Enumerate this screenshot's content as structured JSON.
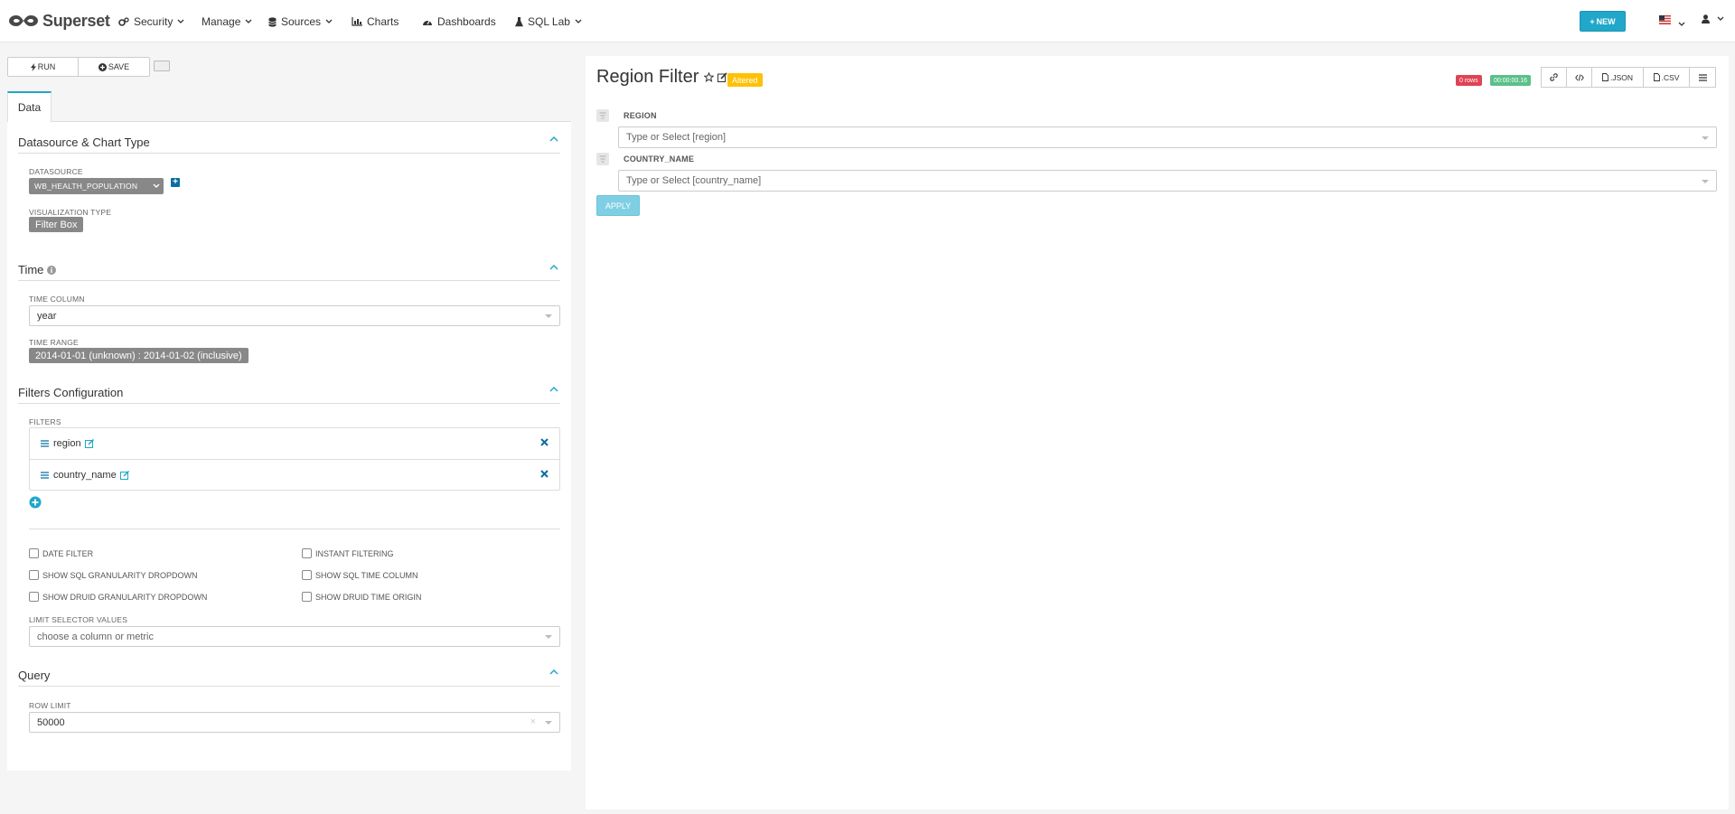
{
  "navbar": {
    "brand": "Superset",
    "items": [
      {
        "label": "Security"
      },
      {
        "label": "Manage"
      },
      {
        "label": "Sources"
      },
      {
        "label": "Charts"
      },
      {
        "label": "Dashboards"
      },
      {
        "label": "SQL Lab"
      }
    ],
    "new_label": "NEW"
  },
  "toolbar": {
    "run_label": "RUN",
    "save_label": "SAVE"
  },
  "tabs": [
    {
      "label": "Data"
    }
  ],
  "sections": {
    "datasource": {
      "title": "Datasource & Chart Type",
      "datasource_label": "DATASOURCE",
      "datasource_value": "WB_HEALTH_POPULATION",
      "viz_label": "VISUALIZATION TYPE",
      "viz_value": "Filter Box"
    },
    "time": {
      "title": "Time",
      "time_column_label": "TIME COLUMN",
      "time_column_value": "year",
      "time_range_label": "TIME RANGE",
      "time_range_value": "2014-01-01 (unknown) : 2014-01-02 (inclusive)"
    },
    "filters": {
      "title": "Filters Configuration",
      "filters_label": "FILTERS",
      "items": [
        {
          "label": "region"
        },
        {
          "label": "country_name"
        }
      ],
      "checkboxes": [
        {
          "label": "DATE FILTER"
        },
        {
          "label": "INSTANT FILTERING"
        },
        {
          "label": "SHOW SQL GRANULARITY DROPDOWN"
        },
        {
          "label": "SHOW SQL TIME COLUMN"
        },
        {
          "label": "SHOW DRUID GRANULARITY DROPDOWN"
        },
        {
          "label": "SHOW DRUID TIME ORIGIN"
        }
      ],
      "limit_label": "LIMIT SELECTOR VALUES",
      "limit_placeholder": "choose a column or metric"
    },
    "query": {
      "title": "Query",
      "row_limit_label": "ROW LIMIT",
      "row_limit_value": "50000",
      "clear_glyph": "×"
    }
  },
  "chart": {
    "title": "Region Filter",
    "altered": "Altered",
    "rows_badge": "0 rows",
    "time_badge": "00:00:00.16",
    "json_label": ".JSON",
    "csv_label": ".CSV",
    "filter_fields": [
      {
        "label": "REGION",
        "placeholder": "Type or Select [region]"
      },
      {
        "label": "COUNTRY_NAME",
        "placeholder": "Type or Select [country_name]"
      }
    ],
    "apply_label": "APPLY"
  },
  "colors": {
    "accent": "#20a7c9",
    "altered": "#ffc107",
    "rows_badge": "#e04355",
    "time_badge": "#5ac189",
    "tag": "#888888"
  }
}
